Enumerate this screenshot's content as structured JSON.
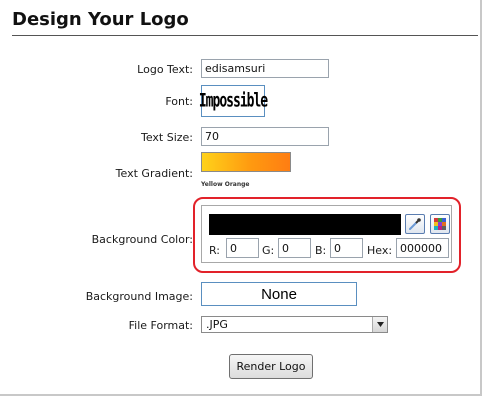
{
  "page": {
    "title": "Design Your Logo"
  },
  "form": {
    "logo_text": {
      "label": "Logo Text:",
      "value": "edisamsuri"
    },
    "font": {
      "label": "Font:",
      "preview_text": "Impossible"
    },
    "text_size": {
      "label": "Text Size:",
      "value": "70"
    },
    "text_gradient": {
      "label": "Text Gradient:",
      "caption": "Yellow Orange",
      "colors": [
        "#ffd21a",
        "#ff7d12"
      ]
    },
    "background_color": {
      "label": "Background Color:",
      "swatch_color": "#000000",
      "r_label": "R:",
      "r_value": "0",
      "g_label": "G:",
      "g_value": "0",
      "b_label": "B:",
      "b_value": "0",
      "hex_label": "Hex:",
      "hex_value": "000000",
      "highlight_color": "#e2222a",
      "tools": [
        "eyedropper-icon",
        "palette-grid-icon"
      ]
    },
    "background_image": {
      "label": "Background Image:",
      "value": "None"
    },
    "file_format": {
      "label": "File Format:",
      "selected": ".JPG"
    },
    "submit": {
      "label": "Render Logo"
    }
  }
}
